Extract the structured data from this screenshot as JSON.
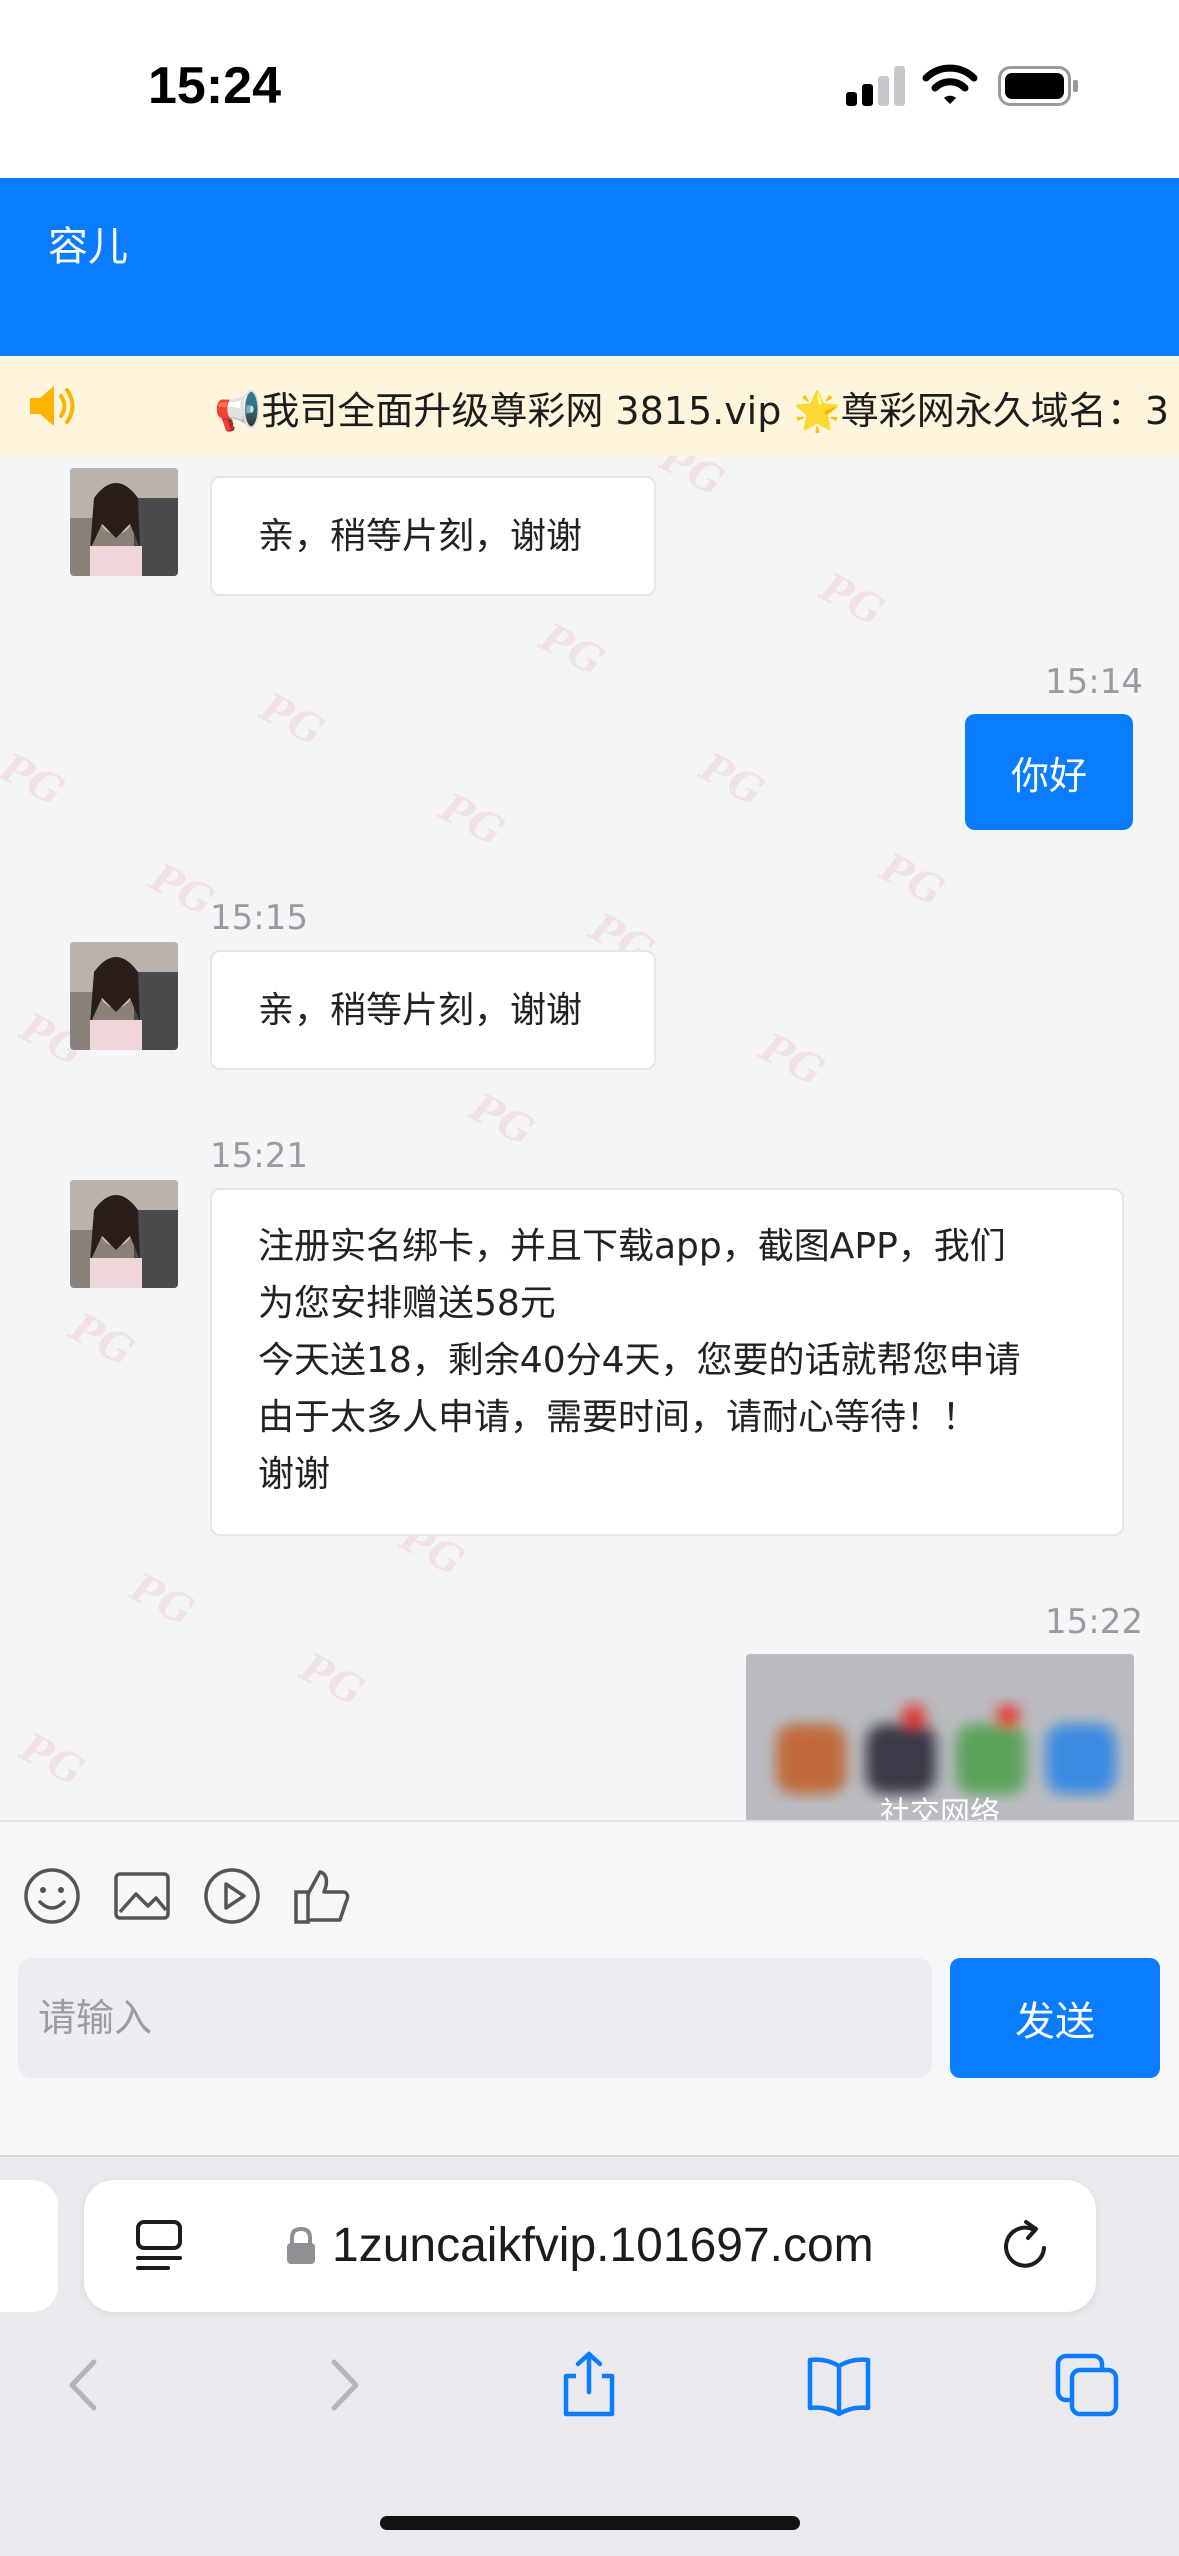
{
  "status": {
    "time": "15:24"
  },
  "header": {
    "title": "容儿"
  },
  "notice": {
    "text_1": "我司全面升级尊彩网 3815.vip",
    "text_2": "尊彩网永久域名：",
    "tail": "3"
  },
  "messages": [
    {
      "side": "in",
      "time": "",
      "text": "亲，稍等片刻，谢谢"
    },
    {
      "side": "out",
      "time": "15:14",
      "text": "你好"
    },
    {
      "side": "in",
      "time": "15:15",
      "text": "亲，稍等片刻，谢谢"
    },
    {
      "side": "in",
      "time": "15:21",
      "lines": [
        "注册实名绑卡，并且下载app，截图APP，我们",
        "为您安排赠送58元",
        "今天送18，剩余40分4天，您要的话就帮您申请",
        "由于太多人申请，需要时间，请耐心等待！！",
        "谢谢"
      ]
    },
    {
      "side": "out",
      "time": "15:22",
      "image_caption": "社交网络"
    }
  ],
  "watermark": "PG",
  "toolbar": {
    "icons": [
      "emoji-icon",
      "image-icon",
      "video-icon",
      "thumbs-up-icon"
    ]
  },
  "composer": {
    "placeholder": "请输入",
    "send_label": "发送"
  },
  "browser": {
    "url": "1zuncaikfvip.101697.com",
    "nav_icons": [
      "back-icon",
      "forward-icon",
      "share-icon",
      "bookmarks-icon",
      "tabs-icon"
    ]
  },
  "colors": {
    "primary": "#0a7cff",
    "notice_bg": "#fdf6dc",
    "chat_bg": "#f5f5f7"
  }
}
